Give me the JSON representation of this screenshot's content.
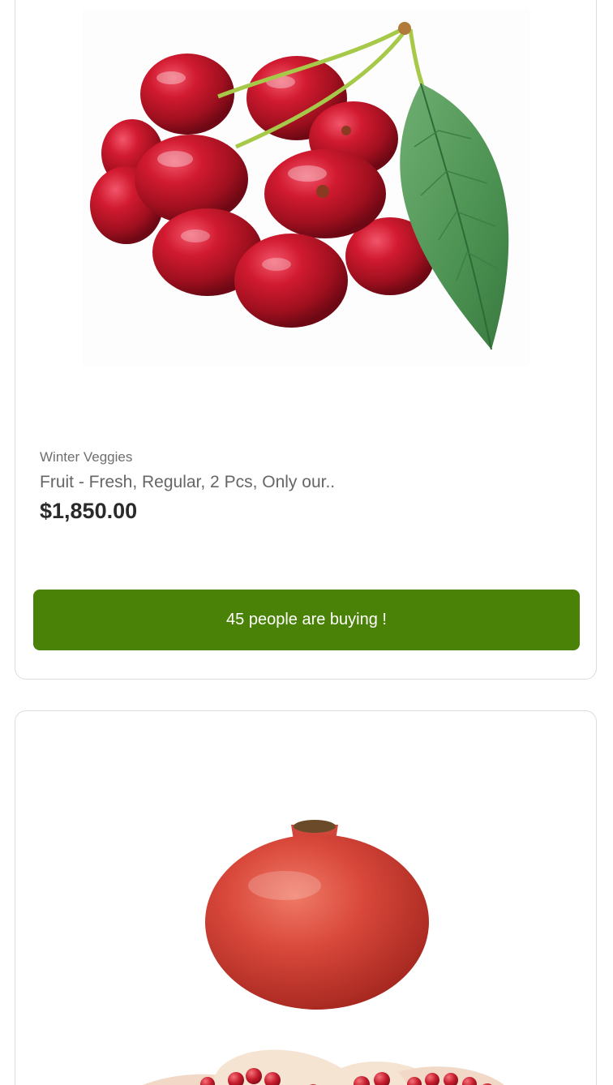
{
  "products": [
    {
      "image": "cherries-image",
      "category": "Winter Veggies",
      "title": "Fruit - Fresh, Regular, 2 Pcs, Only our..",
      "price": "$1,850.00",
      "cta_label": "45 people are buying !"
    },
    {
      "image": "pomegranate-image"
    }
  ],
  "colors": {
    "cta_background": "#4a8207",
    "cta_text": "#ffffff",
    "card_border": "#dcdcdc"
  }
}
